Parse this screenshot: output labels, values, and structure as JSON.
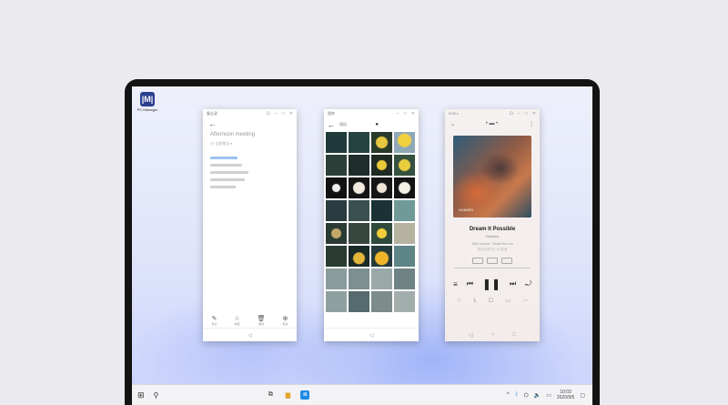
{
  "desktop": {
    "icon_glyph": "|M|",
    "icon_label": "PC Manager"
  },
  "notes_app": {
    "title": "Afternoon meeting",
    "tools": [
      "✎",
      "☆",
      "🗑",
      "⊕"
    ]
  },
  "gallery_app": {},
  "music_app": {
    "brand": "HUAWEI",
    "song_title": "Dream It Possible",
    "artist": "Delacey"
  },
  "taskbar": {
    "time": "10:03",
    "date": "2020/9/5"
  },
  "colors": {
    "screen_bg": "#dfe4fb",
    "accent_blue": "#1e88e5",
    "bezel": "#131313"
  }
}
